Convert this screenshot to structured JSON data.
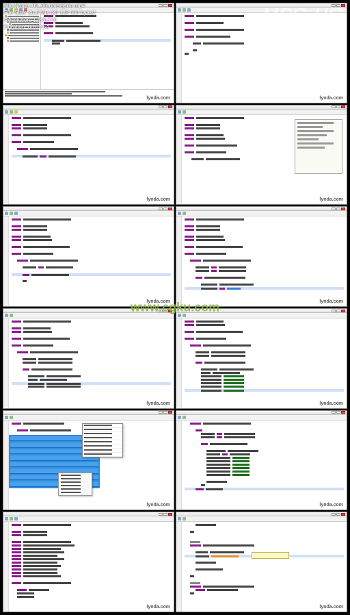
{
  "player": {
    "name": "MPC-HC",
    "info": {
      "filename_label": "File Name:",
      "filename": "03_06-parsejson.mp4",
      "filesize_label": "File Size:",
      "filesize": "26,8 MB (28 128 550 bytes)",
      "resolution_label": "Resolution:",
      "resolution": "1280x720",
      "duration_label": "Duration:",
      "duration": "00:09:54"
    }
  },
  "watermarks": {
    "site": "lynda.com",
    "center": "www.cgku.com"
  },
  "code": {
    "package": "package com.hencodedtutorial.catalog.parsers;",
    "imports": [
      "import java.util.List;",
      "import java.util.ArrayList;",
      "import org.json.JSONArray;",
      "import org.json.JSONObject;",
      "import com.hencodedtutorial.catalog.model.Flower;"
    ],
    "class_decl": "public class FlowerJSONParser {",
    "method_decl": "public static List<Flower> parseFeed(String content) {",
    "body_lines": [
      "JSONArray ar = new JSONArray(content);",
      "List<Flower> flowerList = new ArrayList<>();",
      "for (int i = 0; i < ar.length(); i++) {",
      "JSONObject obj = ar.getJSONObject(i);",
      "Flower flower = new Flower();",
      "flower.setFlowerId(obj.getInt(\"flowerId\"));",
      "flower.setName(obj.getString(\"name\"));",
      "flower.setCategory(obj.getString(\"category\"));",
      "flower.setInstructions(obj.getString(\"instructions\"));",
      "flower.setPhoto(obj.getString(\"photo\"));",
      "flower.setPrice(obj.getDouble(\"price\"));",
      "flowerList.add(flower);",
      "}",
      "return flowerList;"
    ],
    "try_lines": [
      "try {",
      "} catch (JSONException e) {",
      "e.printStackTrace();",
      "return null;",
      "}"
    ]
  },
  "thumbs": [
    {
      "id": 0,
      "kind": "ide-split"
    },
    {
      "id": 1,
      "kind": "editor-basic"
    },
    {
      "id": 2,
      "kind": "editor-hl"
    },
    {
      "id": 3,
      "kind": "editor-popup"
    },
    {
      "id": 4,
      "kind": "editor-code"
    },
    {
      "id": 5,
      "kind": "editor-code-more"
    },
    {
      "id": 6,
      "kind": "editor-code"
    },
    {
      "id": 7,
      "kind": "editor-code-more"
    },
    {
      "id": 8,
      "kind": "blue-menu"
    },
    {
      "id": 9,
      "kind": "editor-full"
    },
    {
      "id": 10,
      "kind": "editor-tooltip"
    },
    {
      "id": 11,
      "kind": "editor-long"
    }
  ]
}
